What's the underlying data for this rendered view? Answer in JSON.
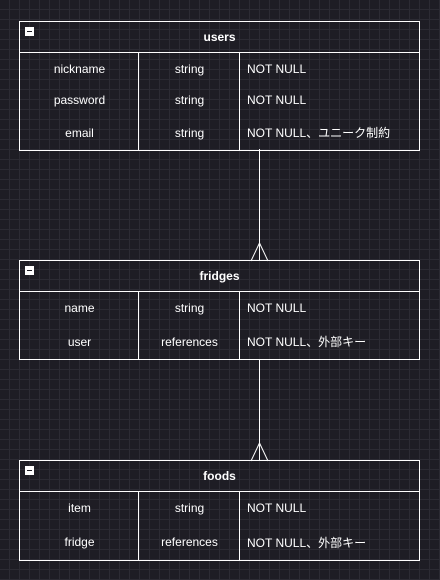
{
  "diagram": {
    "tables": [
      {
        "name": "users",
        "columns": [
          {
            "name": "nickname",
            "type": "string",
            "constraint": "NOT NULL"
          },
          {
            "name": "password",
            "type": "string",
            "constraint": "NOT NULL"
          },
          {
            "name": "email",
            "type": "string",
            "constraint": "NOT NULL、ユニーク制約"
          }
        ]
      },
      {
        "name": "fridges",
        "columns": [
          {
            "name": "name",
            "type": "string",
            "constraint": "NOT NULL"
          },
          {
            "name": "user",
            "type": "references",
            "constraint": "NOT NULL、外部キー"
          }
        ]
      },
      {
        "name": "foods",
        "columns": [
          {
            "name": "item",
            "type": "string",
            "constraint": "NOT NULL"
          },
          {
            "name": "fridge",
            "type": "references",
            "constraint": "NOT NULL、外部キー"
          }
        ]
      }
    ],
    "relationships": [
      {
        "from": "users",
        "to": "fridges",
        "cardinality": "one-to-many"
      },
      {
        "from": "fridges",
        "to": "foods",
        "cardinality": "one-to-many"
      }
    ]
  }
}
